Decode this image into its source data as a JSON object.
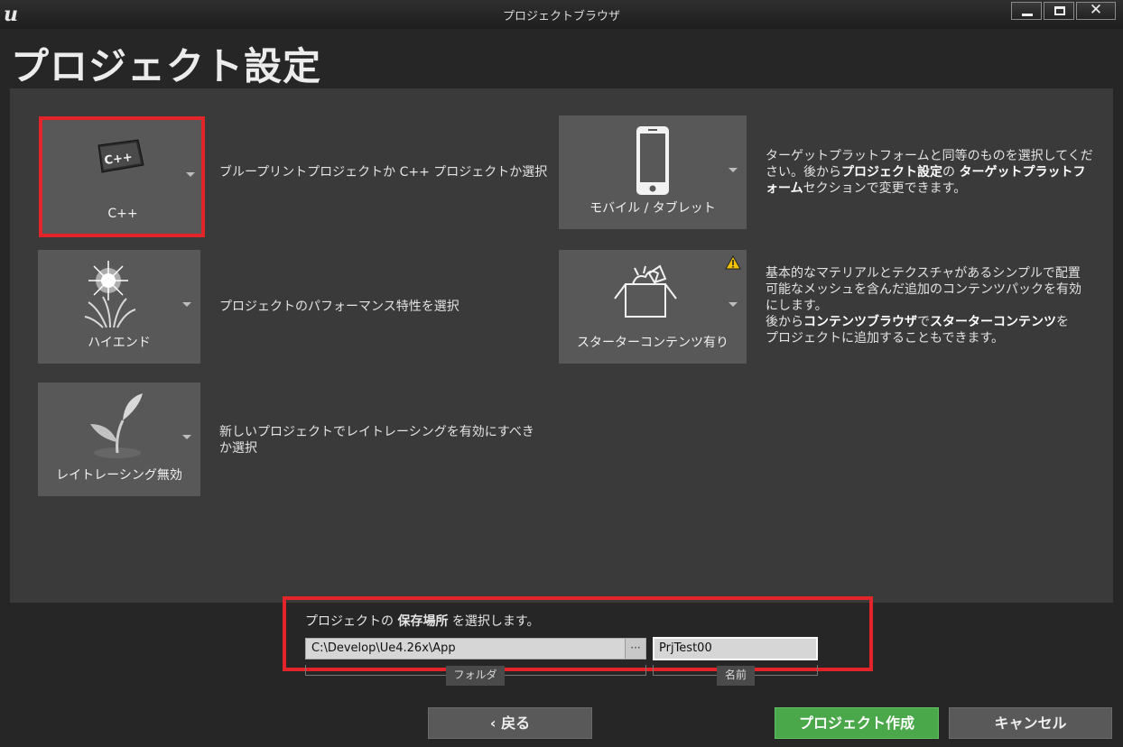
{
  "window": {
    "title": "プロジェクトブラウザ",
    "minimize_icon": "minimize-icon",
    "maximize_icon": "maximize-icon",
    "close_glyph": "✕"
  },
  "page_title": "プロジェクト設定",
  "tiles": {
    "code": {
      "label": "C++",
      "description": "ブループリントプロジェクトか C++ プロジェクトか選択",
      "icon": "cpp-keyboard-key-icon"
    },
    "quality": {
      "label": "ハイエンド",
      "description": "プロジェクトのパフォーマンス特性を選択",
      "icon": "high-end-sparkle-icon"
    },
    "raytracing": {
      "label": "レイトレーシング無効",
      "description_line1": "新しいプロジェクトでレイトレーシングを有効にすべき",
      "description_line2": "か選択",
      "icon": "plant-leaf-icon"
    },
    "platform": {
      "label": "モバイル / タブレット",
      "icon": "mobile-phone-icon",
      "desc_1": "ターゲットプラットフォームと同等のものを選択してくだ",
      "desc_2a": "さい。後から",
      "desc_2b": "プロジェクト設定",
      "desc_2c": "の ",
      "desc_2d": "ターゲットプラットフ",
      "desc_3a": "ォーム",
      "desc_3b": "セクションで変更できます。"
    },
    "starter": {
      "label": "スターターコンテンツ有り",
      "icon": "starter-content-box-icon",
      "warning_icon": "warning-icon",
      "desc_1": "基本的なマテリアルとテクスチャがあるシンプルで配置",
      "desc_2": "可能なメッシュを含んだ追加のコンテンツパックを有効",
      "desc_3": "にします。",
      "desc_4a": "後から",
      "desc_4b": "コンテンツブラウザ",
      "desc_4c": "で",
      "desc_4d": "スターターコンテンツ",
      "desc_4e": "を",
      "desc_5": "プロジェクトに追加することもできます。"
    }
  },
  "location": {
    "label_prefix": "プロジェクトの ",
    "label_bold": "保存場所",
    "label_suffix": " を選択します。",
    "folder_value": "C:\\Develop\\Ue4.26x\\App",
    "browse_label": "···",
    "folder_caption": "フォルダ",
    "name_value": "PrjTest00",
    "name_caption": "名前"
  },
  "buttons": {
    "back": "‹ 戻る",
    "create": "プロジェクト作成",
    "cancel": "キャンセル"
  },
  "colors": {
    "highlight": "#e3242b",
    "create_button": "#4aa84a",
    "tile": "#585858"
  }
}
